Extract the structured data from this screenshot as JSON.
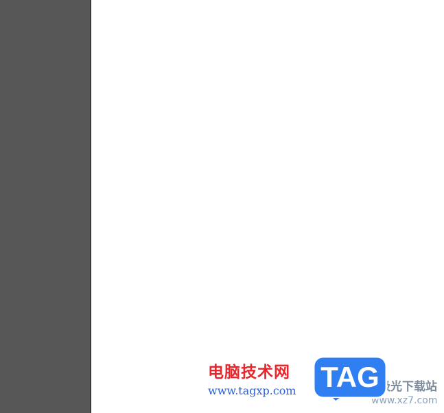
{
  "watermark": {
    "site_name": "电脑技术网",
    "site_url": "www.tagxp.com",
    "logo_text": "TAG",
    "secondary_site_name": "极光下载站",
    "secondary_url": "www.xz7.com"
  },
  "colors": {
    "left_panel": "#575757",
    "canvas": "#ffffff",
    "watermark_red": "#e8262b",
    "watermark_blue": "#2a5fd6",
    "tag_blue": "#2f7ff2"
  }
}
